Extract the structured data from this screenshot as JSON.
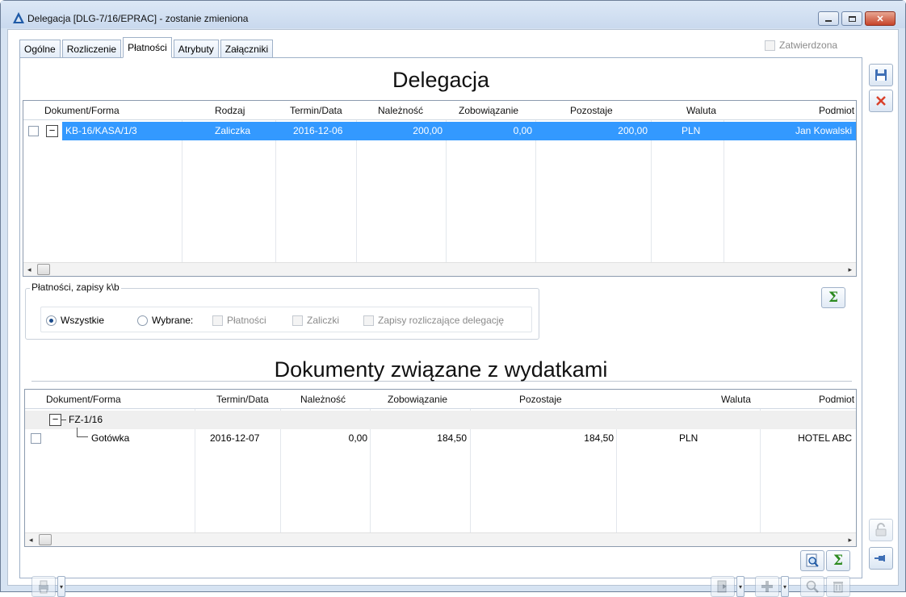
{
  "window": {
    "title": "Delegacja [DLG-7/16/EPRAC] - zostanie zmieniona",
    "minimize_icon": "minimize-icon",
    "maximize_icon": "maximize-icon",
    "close_glyph": "✕"
  },
  "tabs": [
    {
      "label": "Ogólne",
      "active": false
    },
    {
      "label": "Rozliczenie",
      "active": false
    },
    {
      "label": "Płatności",
      "active": true
    },
    {
      "label": "Atrybuty",
      "active": false
    },
    {
      "label": "Załączniki",
      "active": false
    }
  ],
  "approved": {
    "label": "Zatwierdzona",
    "checked": false
  },
  "section1": {
    "title": "Delegacja",
    "columns": [
      "Dokument/Forma",
      "Rodzaj",
      "Termin/Data",
      "Należność",
      "Zobowiązanie",
      "Pozostaje",
      "Waluta",
      "Podmiot"
    ],
    "rows": [
      {
        "document": "KB-16/KASA/1/3",
        "type": "Zaliczka",
        "date": "2016-12-06",
        "receivable": "200,00",
        "liability": "0,00",
        "remaining": "200,00",
        "currency": "PLN",
        "entity": "Jan  Kowalski",
        "selected": true
      }
    ]
  },
  "filter": {
    "legend": "Płatności, zapisy k\\b",
    "option_all": "Wszystkie",
    "option_selected": "Wybrane:",
    "cb_payments": "Płatności",
    "cb_advances": "Zaliczki",
    "cb_settling": "Zapisy rozliczające delegację"
  },
  "section2": {
    "title": "Dokumenty związane z wydatkami",
    "columns": [
      "Dokument/Forma",
      "Termin/Data",
      "Należność",
      "Zobowiązanie",
      "Pozostaje",
      "Waluta",
      "Podmiot"
    ],
    "group": "FZ-1/16",
    "rows": [
      {
        "document": "Gotówka",
        "date": "2016-12-07",
        "receivable": "0,00",
        "liability": "184,50",
        "remaining": "184,50",
        "currency": "PLN",
        "entity": "HOTEL ABC"
      }
    ]
  },
  "colors": {
    "selection": "#3399ff",
    "group_row": "#efefef",
    "accent_green": "#2c8a1f",
    "close_red": "#d9412a"
  }
}
